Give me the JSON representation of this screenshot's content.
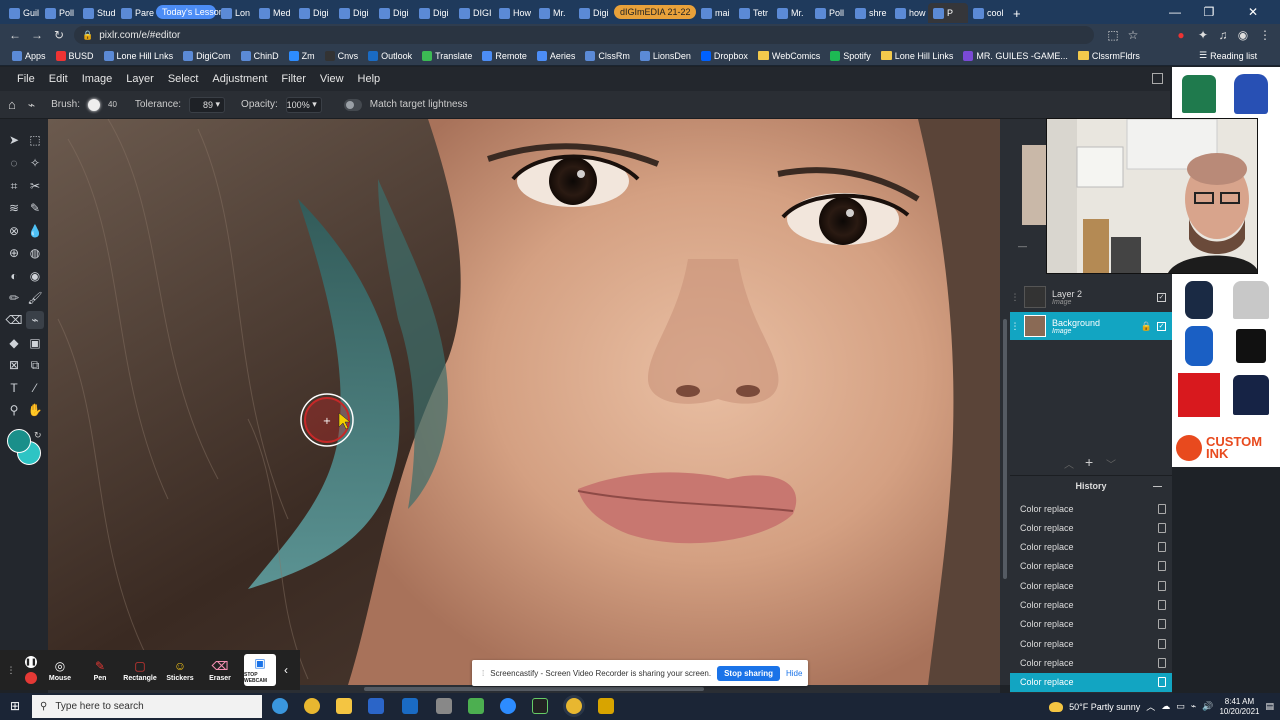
{
  "browser": {
    "tabs": [
      "Guil",
      "Poll",
      "Stud",
      "Pare",
      "Today's Lesson",
      "Lon",
      "Med",
      "Digi",
      "Digi",
      "Digi",
      "Digi",
      "DIGI",
      "How",
      "Mr.",
      "Digi",
      "dIGImEDIA 21-22",
      "mai",
      "Tetr",
      "Mr.",
      "Poll",
      "shre",
      "how",
      "P",
      "cool"
    ],
    "url": "pixlr.com/e/#editor",
    "bookmarks": [
      "Apps",
      "BUSD",
      "Lone Hill Lnks",
      "DigiCom",
      "ChinD",
      "Zm",
      "Cnvs",
      "Outlook",
      "Translate",
      "Remote",
      "Aeries",
      "ClssRm",
      "LionsDen",
      "Dropbox",
      "WebComics",
      "Spotify",
      "Lone Hill Links",
      "MR. GUILES -GAME...",
      "ClssrmFldrs"
    ],
    "reading_list": "Reading list"
  },
  "editor": {
    "menu": [
      "File",
      "Edit",
      "Image",
      "Layer",
      "Select",
      "Adjustment",
      "Filter",
      "View",
      "Help"
    ],
    "options": {
      "brush_label": "Brush:",
      "brush_size": "40",
      "tolerance_label": "Tolerance:",
      "tolerance_value": "89",
      "opacity_label": "Opacity:",
      "opacity_value": "100%",
      "match_label": "Match target lightness"
    },
    "colors": {
      "primary": "#1a8f8a",
      "secondary": "#2ec4c4",
      "accent": "#12a5c2"
    }
  },
  "layers": [
    {
      "name": "Layer 2",
      "type": "Image"
    },
    {
      "name": "Background",
      "type": "Image"
    }
  ],
  "history": {
    "title": "History",
    "items": [
      "Color replace",
      "Color replace",
      "Color replace",
      "Color replace",
      "Color replace",
      "Color replace",
      "Color replace",
      "Color replace",
      "Color replace",
      "Color replace"
    ]
  },
  "ad": {
    "brand": "CUSTOM INK"
  },
  "screencastify": {
    "tools": [
      "Mouse",
      "Pen",
      "Rectangle",
      "Stickers",
      "Eraser",
      "STOP WEBCAM"
    ],
    "share_message": "Screencastify - Screen Video Recorder is sharing your screen.",
    "stop_label": "Stop sharing",
    "hide_label": "Hide"
  },
  "taskbar": {
    "search_placeholder": "Type here to search",
    "weather": "50°F  Partly sunny",
    "time": "8:41 AM",
    "date": "10/20/2021"
  }
}
